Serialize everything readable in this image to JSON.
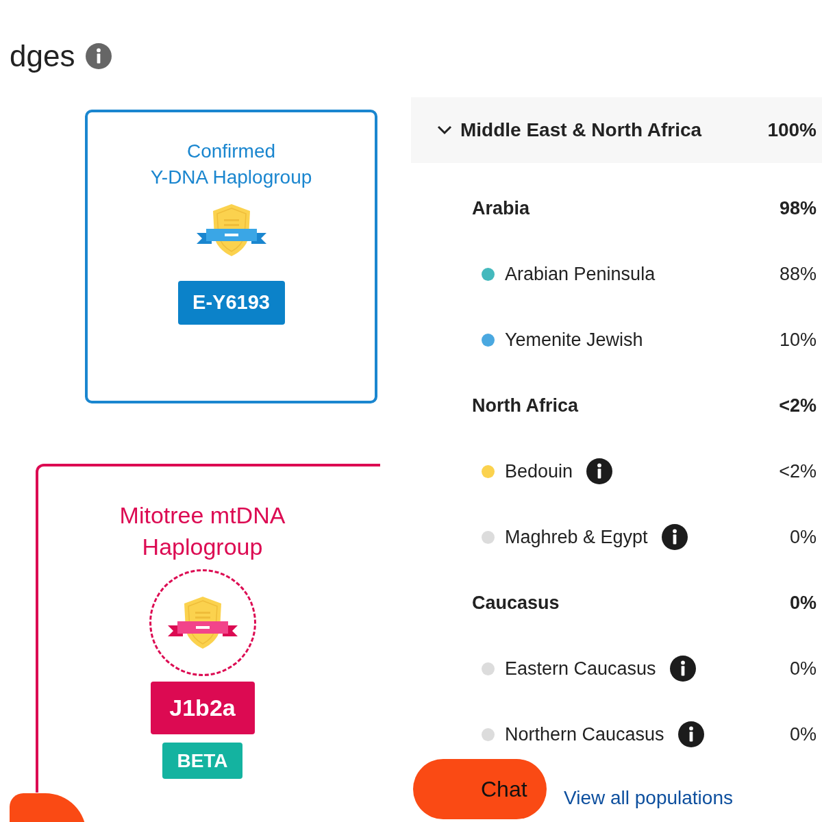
{
  "heading": {
    "text": "dges"
  },
  "badges": [
    {
      "kind": "confirmed",
      "title_lines": [
        "Confirmed",
        "Y-DNA Haplogroup"
      ],
      "value": "E-Y6193"
    },
    {
      "kind": "mitotree",
      "title_lines": [
        "Mitotree mtDNA",
        "Haplogroup"
      ],
      "value": "J1b2a",
      "tag": "BETA"
    }
  ],
  "region": {
    "name": "Middle East & North Africa",
    "percent": "100%",
    "expanded": true
  },
  "groups": [
    {
      "name": "Arabia",
      "percent": "98%",
      "children": [
        {
          "name": "Arabian Peninsula",
          "percent": "88%",
          "color": "#44b9bd",
          "info": false
        },
        {
          "name": "Yemenite Jewish",
          "percent": "10%",
          "color": "#4aa8e0",
          "info": false
        }
      ]
    },
    {
      "name": "North Africa",
      "percent": "<2%",
      "children": [
        {
          "name": "Bedouin",
          "percent": "<2%",
          "color": "#fbd24e",
          "info": true
        },
        {
          "name": "Maghreb & Egypt",
          "percent": "0%",
          "color": "#dcdcdc",
          "info": true
        }
      ]
    },
    {
      "name": "Caucasus",
      "percent": "0%",
      "children": [
        {
          "name": "Eastern Caucasus",
          "percent": "0%",
          "color": "#dcdcdc",
          "info": true
        },
        {
          "name": "Northern Caucasus",
          "percent": "0%",
          "color": "#dcdcdc",
          "info": true
        }
      ]
    }
  ],
  "chat_button": {
    "label": "Chat"
  },
  "view_all_link": {
    "label": "View all populations"
  }
}
